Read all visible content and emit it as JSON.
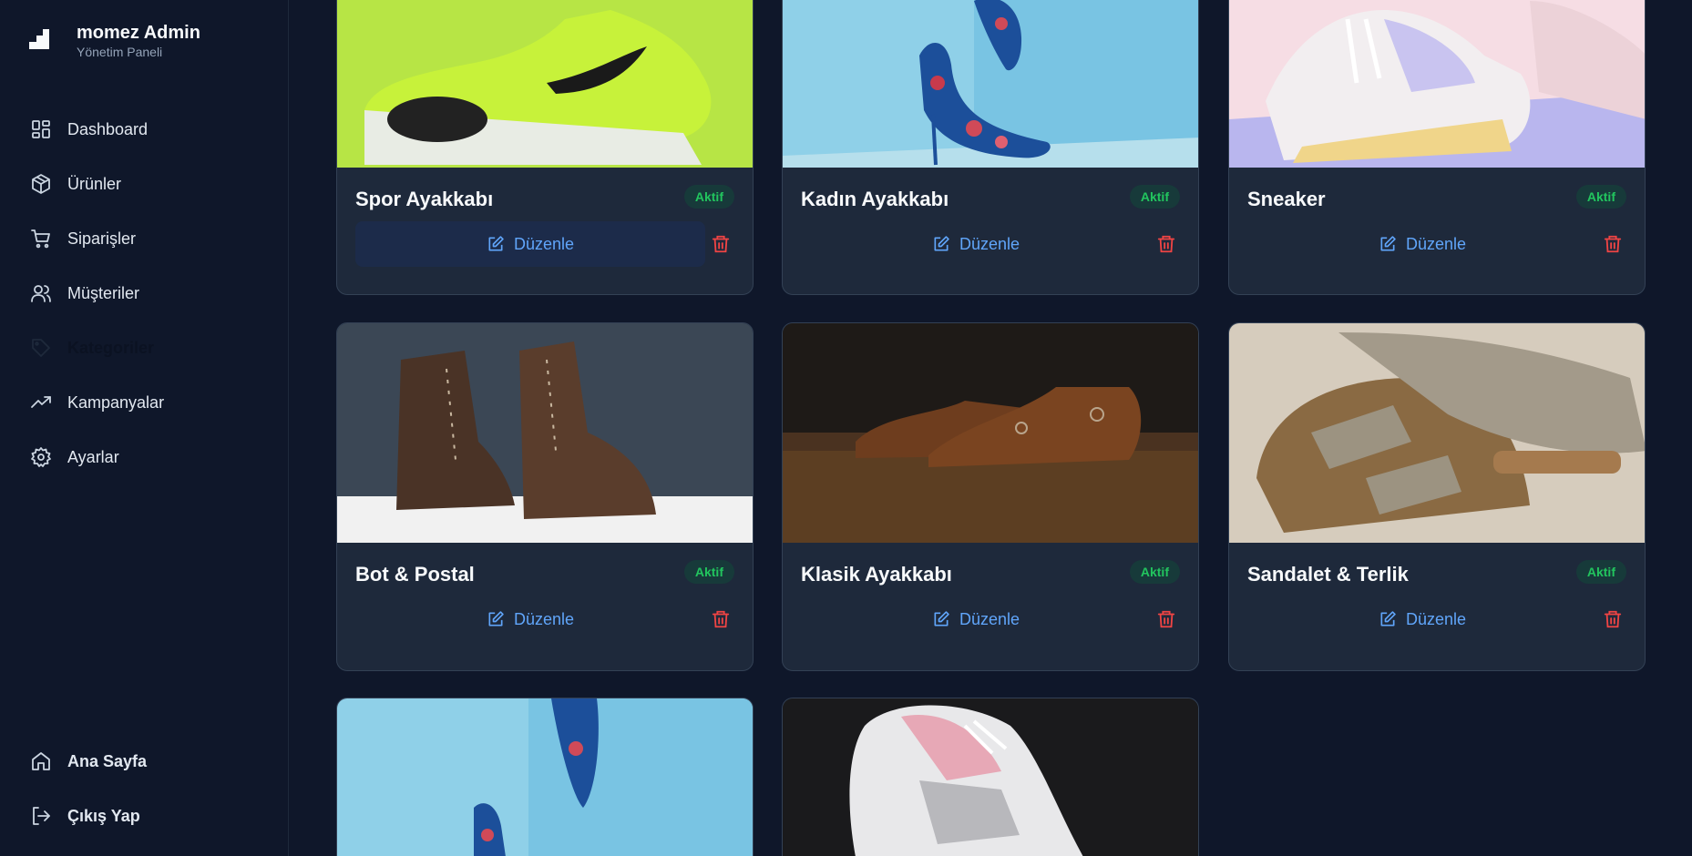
{
  "brand": {
    "title": "momez Admin",
    "subtitle": "Yönetim Paneli"
  },
  "nav": [
    {
      "label": "Dashboard"
    },
    {
      "label": "Ürünler"
    },
    {
      "label": "Siparişler"
    },
    {
      "label": "Müşteriler"
    },
    {
      "label": "Kategoriler"
    },
    {
      "label": "Kampanyalar"
    },
    {
      "label": "Ayarlar"
    }
  ],
  "nav_bottom": [
    {
      "label": "Ana Sayfa"
    },
    {
      "label": "Çıkış Yap"
    }
  ],
  "cards": [
    {
      "title": "Spor Ayakkabı",
      "status": "Aktif",
      "edit": "Düzenle"
    },
    {
      "title": "Kadın Ayakkabı",
      "status": "Aktif",
      "edit": "Düzenle"
    },
    {
      "title": "Sneaker",
      "status": "Aktif",
      "edit": "Düzenle"
    },
    {
      "title": "Bot & Postal",
      "status": "Aktif",
      "edit": "Düzenle"
    },
    {
      "title": "Klasik Ayakkabı",
      "status": "Aktif",
      "edit": "Düzenle"
    },
    {
      "title": "Sandalet & Terlik",
      "status": "Aktif",
      "edit": "Düzenle"
    }
  ],
  "colors": {
    "accent": "#60a5fa",
    "success": "#22c55e",
    "danger": "#ef4444",
    "card_bg": "#1e293b",
    "page_bg": "#0f172a"
  }
}
